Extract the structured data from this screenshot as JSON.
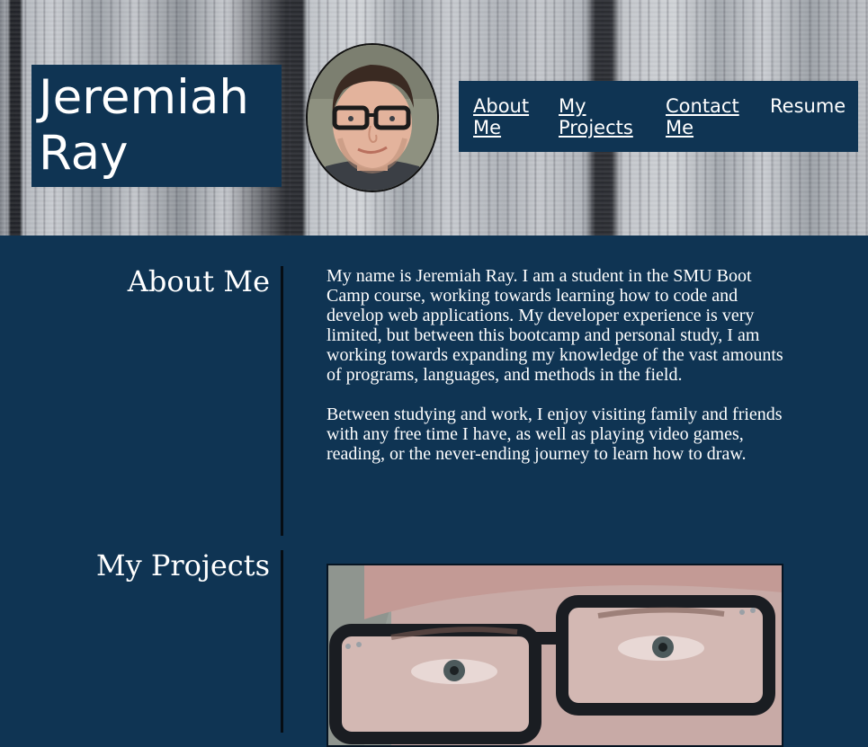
{
  "header": {
    "name": "Jeremiah Ray",
    "nav": [
      {
        "label": "About Me"
      },
      {
        "label": "My Projects"
      },
      {
        "label": "Contact Me"
      },
      {
        "label": "Resume"
      }
    ]
  },
  "about": {
    "title": "About Me",
    "paragraphs": [
      "My name is Jeremiah Ray. I am a student in the SMU Boot Camp course, working towards learning how to code and develop web applications. My developer experience is very limited, but between this bootcamp and personal study, I am working towards expanding my knowledge of the vast amounts of programs, languages, and methods in the field.",
      "Between studying and work, I enjoy visiting family and friends with any free time I have, as well as playing video games, reading, or the never-ending journey to learn how to draw."
    ]
  },
  "projects": {
    "title": "My Projects"
  },
  "colors": {
    "navy": "#0f3453",
    "text": "#ffffff"
  }
}
